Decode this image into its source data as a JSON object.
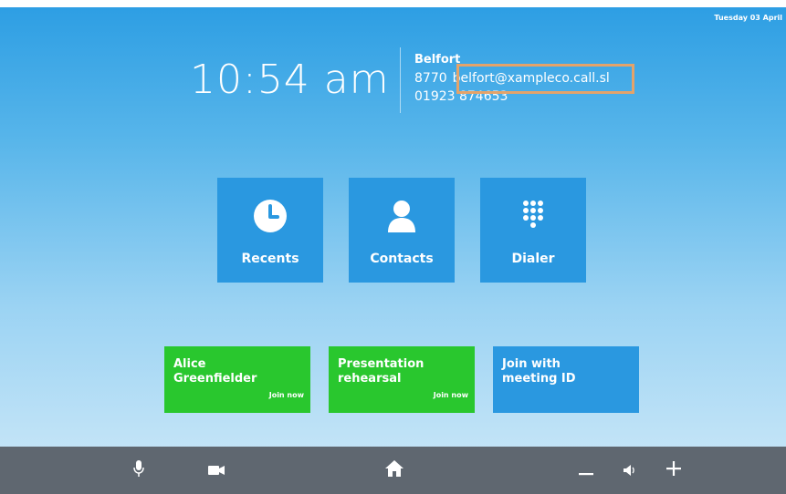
{
  "status": {
    "date": "Tuesday 03 April"
  },
  "clock": {
    "time": "10:54 am"
  },
  "info": {
    "name": "Belfort",
    "extension": "8770",
    "sip_address": "belfort@xampleco.call.sl",
    "phone": "01923 874653"
  },
  "tiles": [
    {
      "label": "Recents",
      "icon": "clock-icon"
    },
    {
      "label": "Contacts",
      "icon": "person-icon"
    },
    {
      "label": "Dialer",
      "icon": "keypad-icon"
    }
  ],
  "meetings": [
    {
      "line1": "Alice",
      "line2": "Greenfielder",
      "action": "Join now",
      "color": "#29c72e"
    },
    {
      "line1": "Presentation",
      "line2": "rehearsal",
      "action": "Join now",
      "color": "#29c72e"
    },
    {
      "line1": "Join with",
      "line2": "meeting ID",
      "color": "#2a98e0"
    }
  ],
  "toolbar": {
    "icons": [
      "microphone-icon",
      "camera-icon",
      "home-icon",
      "volume-down-icon",
      "speaker-icon",
      "volume-up-icon"
    ]
  },
  "colors": {
    "tile_blue": "#2a98e0",
    "meeting_green": "#29c72e",
    "highlight_orange": "#e4a36a",
    "toolbar_gray": "#5f6770"
  }
}
